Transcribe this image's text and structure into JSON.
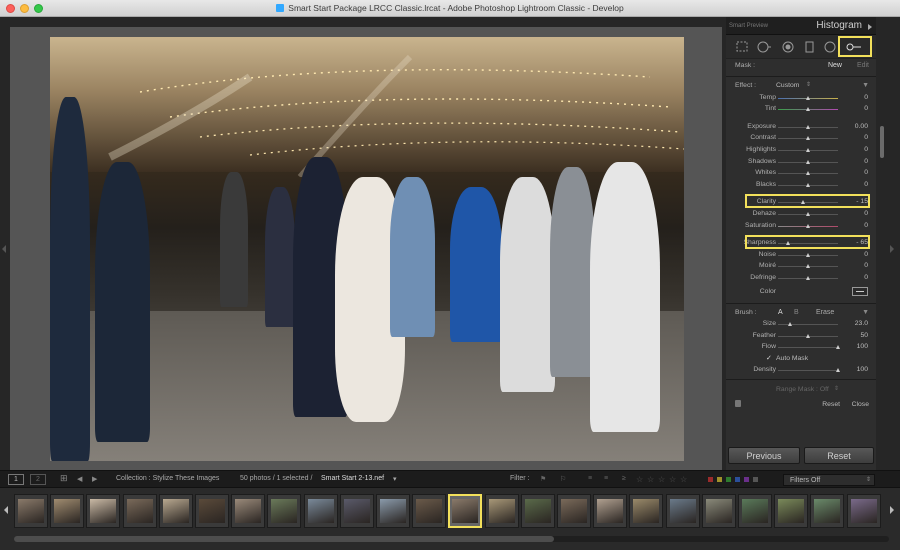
{
  "window": {
    "title": "Smart Start Package LRCC Classic.lrcat - Adobe Photoshop Lightroom Classic - Develop"
  },
  "panel": {
    "smart_preview": "Smart Preview",
    "histogram": "Histogram",
    "mask_label": "Mask :",
    "mask_new": "New",
    "mask_edit": "Edit",
    "effect_label": "Effect :",
    "effect_value": "Custom",
    "sliders_top": [
      {
        "label": "Temp",
        "value": "0"
      },
      {
        "label": "Tint",
        "value": "0"
      }
    ],
    "sliders_tone": [
      {
        "label": "Exposure",
        "value": "0.00"
      },
      {
        "label": "Contrast",
        "value": "0"
      },
      {
        "label": "Highlights",
        "value": "0"
      },
      {
        "label": "Shadows",
        "value": "0"
      },
      {
        "label": "Whites",
        "value": "0"
      },
      {
        "label": "Blacks",
        "value": "0"
      }
    ],
    "sliders_presence": [
      {
        "label": "Clarity",
        "value": "- 15"
      },
      {
        "label": "Dehaze",
        "value": "0"
      },
      {
        "label": "Saturation",
        "value": "0"
      }
    ],
    "sliders_detail": [
      {
        "label": "Sharpness",
        "value": "- 65"
      },
      {
        "label": "Noise",
        "value": "0"
      },
      {
        "label": "Moiré",
        "value": "0"
      },
      {
        "label": "Defringe",
        "value": "0"
      }
    ],
    "color_label": "Color",
    "brush": {
      "label": "Brush :",
      "a": "A",
      "b": "B",
      "erase": "Erase",
      "size_label": "Size",
      "size_value": "23.0",
      "feather_label": "Feather",
      "feather_value": "50",
      "flow_label": "Flow",
      "flow_value": "100",
      "auto_mask": "Auto Mask",
      "density_label": "Density",
      "density_value": "100"
    },
    "range_mask": "Range Mask : Off",
    "reset_small": "Reset",
    "close_small": "Close",
    "previous": "Previous",
    "reset": "Reset"
  },
  "filmbar": {
    "view1": "1",
    "view2": "2",
    "collection": "Collection : Stylize These Images",
    "count": "50 photos / 1 selected /",
    "filename": "Smart Start 2-13.nef",
    "filter": "Filter :",
    "filters_off": "Filters Off"
  },
  "filmstrip": {
    "selected_index": 12,
    "thumb_count": 24
  },
  "colors": {
    "highlight": "#f2e05b",
    "panel_bg": "#2e2e2e"
  }
}
